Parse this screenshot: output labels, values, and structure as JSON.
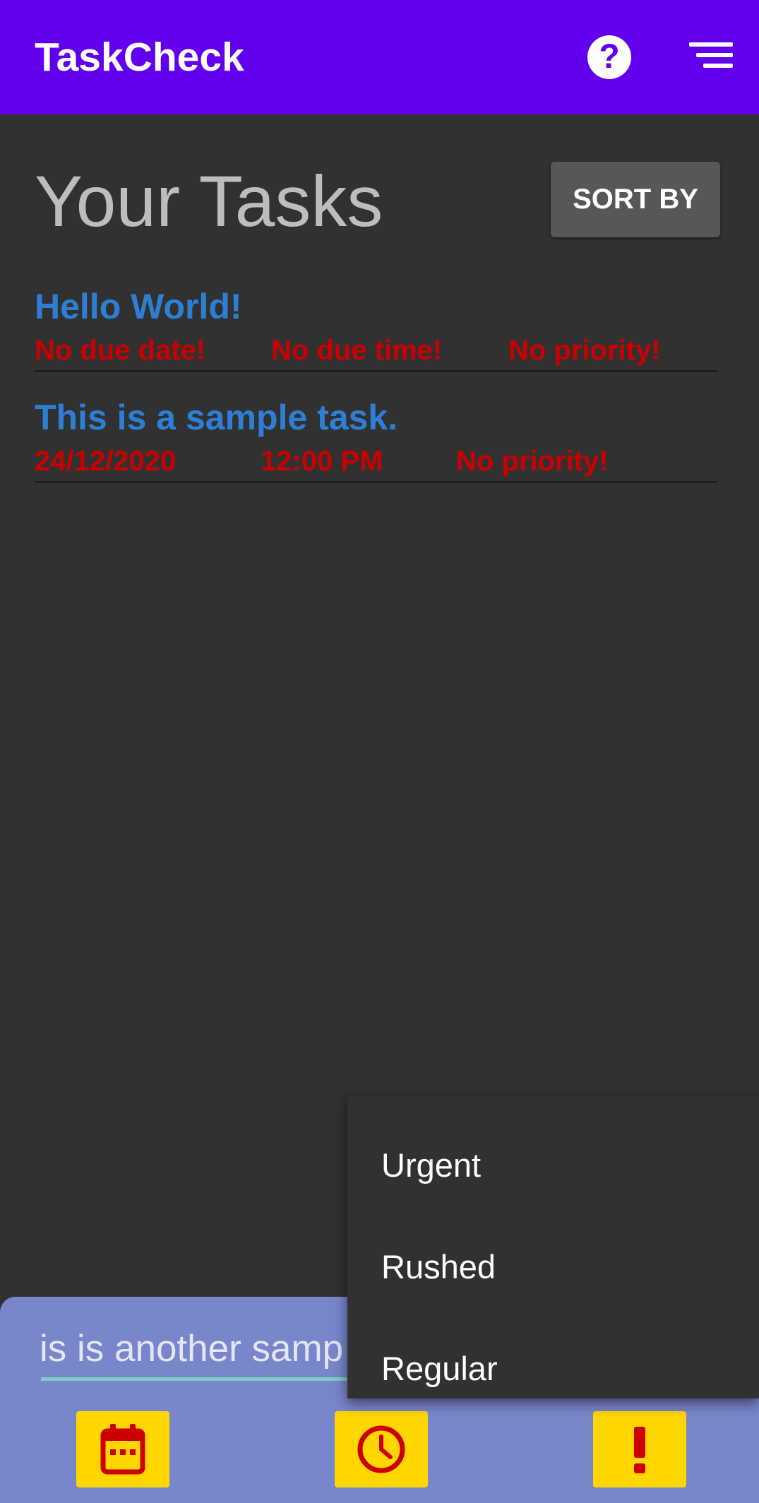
{
  "app": {
    "title": "TaskCheck",
    "help_icon": "help-circle-icon",
    "sort_icon": "sort-lines-icon",
    "accent_color": "#6200ee"
  },
  "main": {
    "heading": "Your Tasks",
    "sort_button_label": "SORT BY"
  },
  "tasks": [
    {
      "title": "Hello World!",
      "date": "No due date!",
      "time": "No due time!",
      "priority": "No priority!"
    },
    {
      "title": "This is a sample task.",
      "date": "24/12/2020",
      "time": "12:00 PM",
      "priority": "No priority!"
    }
  ],
  "new_task": {
    "input_value": "is is another samp",
    "date_icon": "calendar-icon",
    "time_icon": "clock-icon",
    "priority_icon": "exclamation-icon"
  },
  "priority_menu": {
    "items": [
      "Urgent",
      "Rushed",
      "Regular"
    ]
  },
  "colors": {
    "task_title": "#2d7fd6",
    "task_meta": "#cc0000",
    "action_button": "#ffd600",
    "sheet": "#7986cb"
  }
}
